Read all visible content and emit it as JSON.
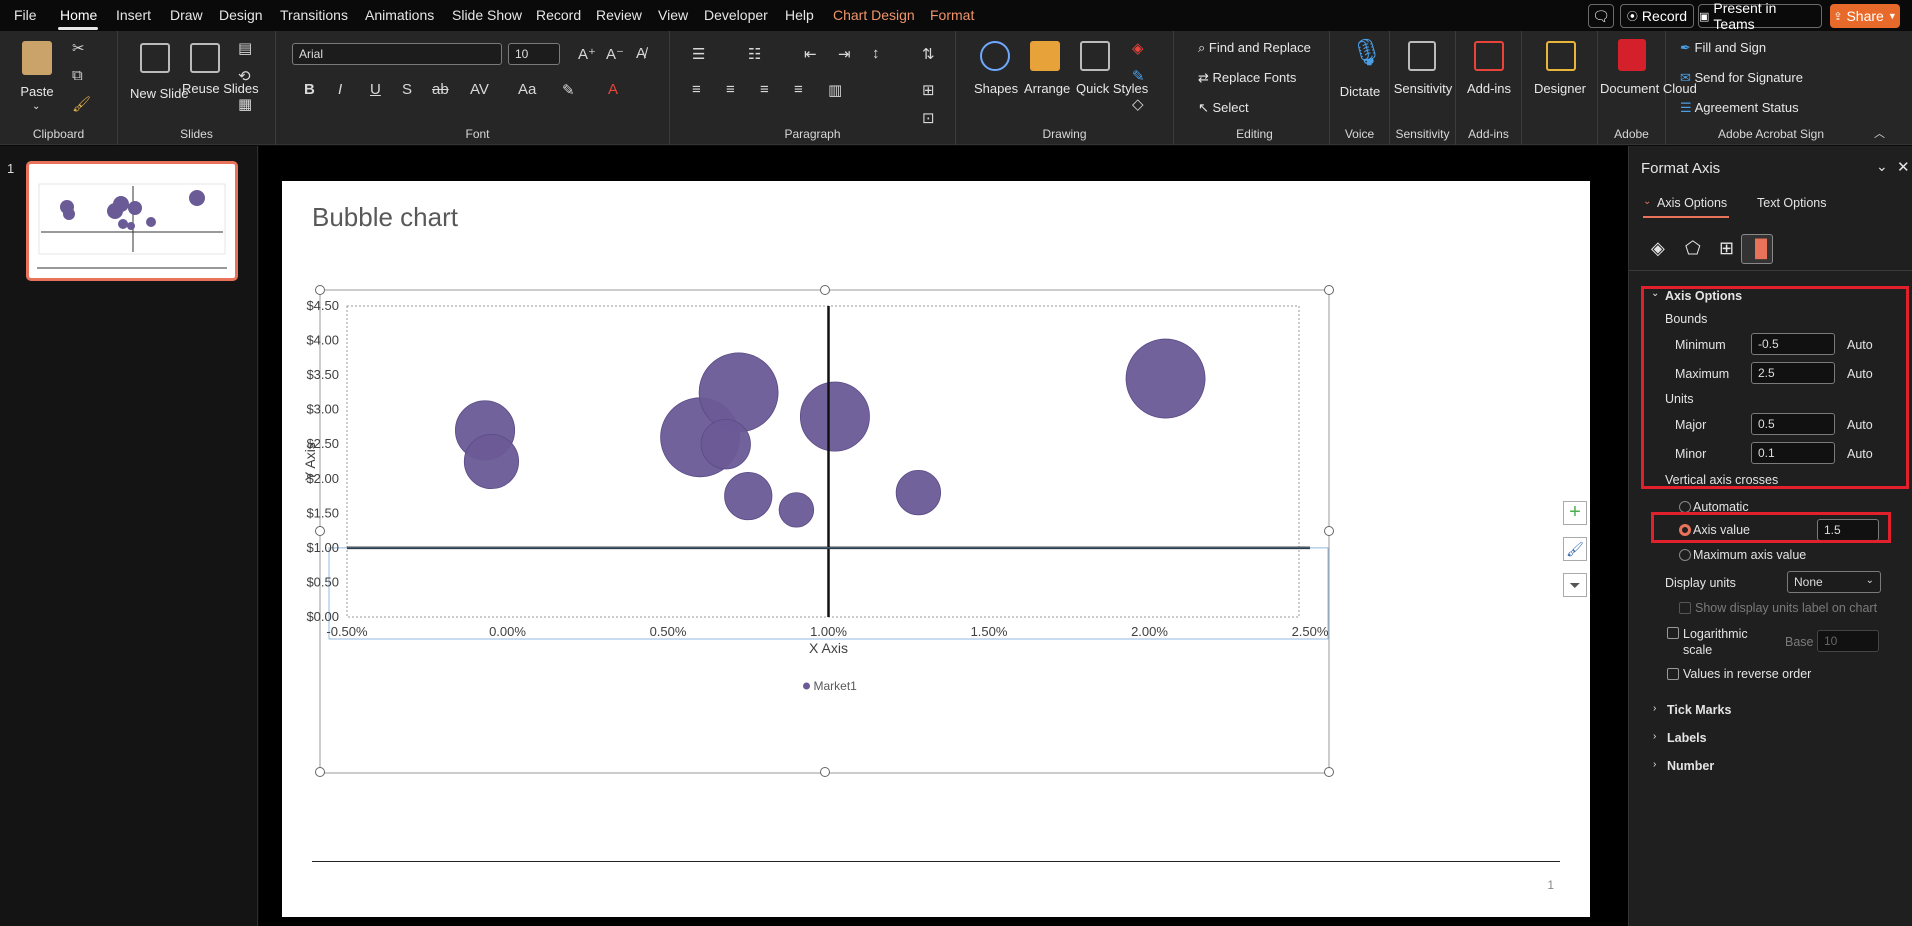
{
  "menu": {
    "tabs": [
      "File",
      "Home",
      "Insert",
      "Draw",
      "Design",
      "Transitions",
      "Animations",
      "Slide Show",
      "Record",
      "Review",
      "View",
      "Developer",
      "Help",
      "Chart Design",
      "Format"
    ],
    "record_btn": "Record",
    "present_btn": "Present in Teams",
    "share_btn": "Share"
  },
  "ribbon": {
    "clipboard": {
      "label": "Clipboard",
      "paste": "Paste"
    },
    "slides": {
      "label": "Slides",
      "new_slide": "New Slide",
      "reuse_slides": "Reuse Slides"
    },
    "font": {
      "label": "Font",
      "family": "Arial",
      "size": "10"
    },
    "paragraph": {
      "label": "Paragraph"
    },
    "drawing": {
      "label": "Drawing",
      "shapes": "Shapes",
      "arrange": "Arrange",
      "quick_styles": "Quick Styles"
    },
    "editing": {
      "label": "Editing",
      "find_replace": "Find and Replace",
      "replace_fonts": "Replace Fonts",
      "select": "Select"
    },
    "voice": {
      "label": "Voice",
      "dictate": "Dictate"
    },
    "sensitivity": {
      "label": "Sensitivity",
      "button": "Sensitivity"
    },
    "addins": {
      "label": "Add-ins",
      "button": "Add-ins"
    },
    "designer": {
      "button": "Designer"
    },
    "adobe": {
      "label": "Adobe",
      "document_cloud": "Document Cloud"
    },
    "acrobat": {
      "label": "Adobe Acrobat Sign",
      "fill_sign": "Fill and Sign",
      "send_signature": "Send for Signature",
      "agreement_status": "Agreement Status"
    }
  },
  "thumbnail": {
    "number": "1"
  },
  "slide": {
    "title": "Bubble chart",
    "page_number": "1"
  },
  "chart_data": {
    "type": "bubble",
    "xlabel": "X Axis",
    "ylabel": "Y Axis",
    "xlim": [
      -0.5,
      2.5
    ],
    "ylim": [
      0,
      4.5
    ],
    "x_ticks": [
      "-0.50%",
      "0.00%",
      "0.50%",
      "1.00%",
      "1.50%",
      "2.00%",
      "2.50%"
    ],
    "y_ticks": [
      "$0.00",
      "$0.50",
      "$1.00",
      "$1.50",
      "$2.00",
      "$2.50",
      "$3.00",
      "$3.50",
      "$4.00",
      "$4.50"
    ],
    "vertical_axis_crosses_x": 1.0,
    "horizontal_axis_crosses_y": 1.0,
    "legend": "bottom",
    "series": [
      {
        "name": "Market1",
        "color": "#6a5a96",
        "points": [
          {
            "x": -0.07,
            "y": 2.7,
            "size": 0.6
          },
          {
            "x": -0.05,
            "y": 2.25,
            "size": 0.55
          },
          {
            "x": 0.6,
            "y": 2.6,
            "size": 0.8
          },
          {
            "x": 0.72,
            "y": 3.25,
            "size": 0.8
          },
          {
            "x": 0.68,
            "y": 2.5,
            "size": 0.5
          },
          {
            "x": 0.75,
            "y": 1.75,
            "size": 0.48
          },
          {
            "x": 0.9,
            "y": 1.55,
            "size": 0.35
          },
          {
            "x": 1.02,
            "y": 2.9,
            "size": 0.7
          },
          {
            "x": 1.28,
            "y": 1.8,
            "size": 0.45
          },
          {
            "x": 2.05,
            "y": 3.45,
            "size": 0.8
          }
        ]
      }
    ]
  },
  "format_pane": {
    "title": "Format Axis",
    "tab_axis_options": "Axis Options",
    "tab_text_options": "Text Options",
    "section_axis_options": "Axis Options",
    "bounds": "Bounds",
    "minimum_label": "Minimum",
    "minimum_value": "-0.5",
    "maximum_label": "Maximum",
    "maximum_value": "2.5",
    "units": "Units",
    "major_label": "Major",
    "major_value": "0.5",
    "minor_label": "Minor",
    "minor_value": "0.1",
    "auto": "Auto",
    "vertical_axis_crosses": "Vertical axis crosses",
    "automatic": "Automatic",
    "axis_value": "Axis value",
    "axis_value_input": "1.5",
    "max_axis_value": "Maximum axis value",
    "display_units": "Display units",
    "display_units_value": "None",
    "show_units_label": "Show display units label on chart",
    "logarithmic": "Logarithmic scale",
    "base": "Base",
    "base_value": "10",
    "reverse_order": "Values in reverse order",
    "tick_marks": "Tick Marks",
    "labels": "Labels",
    "number": "Number"
  }
}
